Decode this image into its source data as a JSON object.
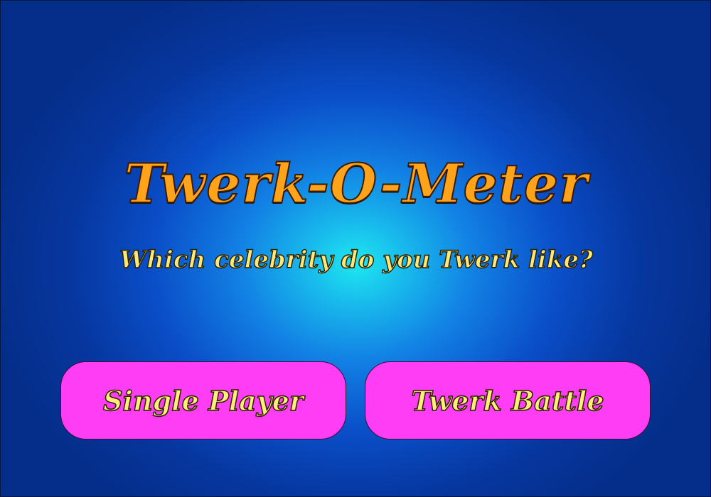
{
  "title": "Twerk-O-Meter",
  "subtitle": "Which celebrity do you Twerk like?",
  "buttons": {
    "single_player": "Single Player",
    "twerk_battle": "Twerk Battle"
  },
  "colors": {
    "background_center": "#1ee8f0",
    "background_edge": "#052e8a",
    "title": "#ffa31a",
    "subtitle": "#ffe87a",
    "button_fill": "#ff3df4",
    "button_text": "#ffee7a"
  }
}
